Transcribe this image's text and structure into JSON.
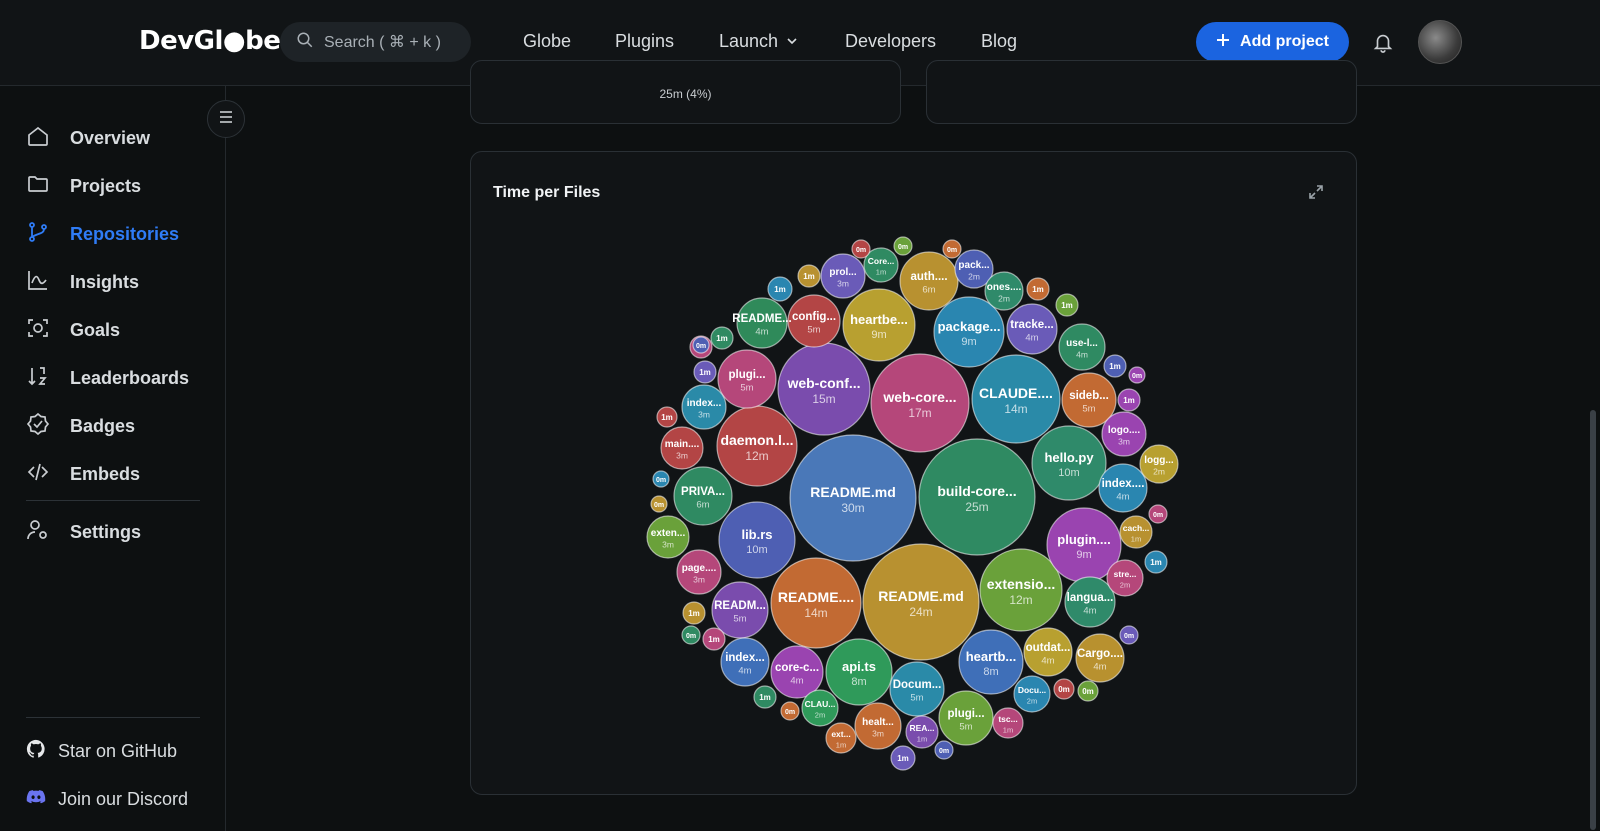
{
  "header": {
    "logo": "DevGl●be",
    "search_placeholder": "Search ( ⌘ + k )",
    "nav": [
      "Globe",
      "Plugins",
      "Launch",
      "Developers",
      "Blog"
    ],
    "add_project": "Add project"
  },
  "sidebar": {
    "items": [
      {
        "label": "Overview",
        "icon": "home-icon",
        "active": false
      },
      {
        "label": "Projects",
        "icon": "folder-icon",
        "active": false
      },
      {
        "label": "Repositories",
        "icon": "git-branch-icon",
        "active": true
      },
      {
        "label": "Insights",
        "icon": "chart-icon",
        "active": false
      },
      {
        "label": "Goals",
        "icon": "target-icon",
        "active": false
      },
      {
        "label": "Leaderboards",
        "icon": "sort-icon",
        "active": false
      },
      {
        "label": "Badges",
        "icon": "badge-icon",
        "active": false
      },
      {
        "label": "Embeds",
        "icon": "code-icon",
        "active": false
      },
      {
        "label": "Settings",
        "icon": "user-settings-icon",
        "active": false
      }
    ],
    "footer": [
      {
        "label": "Star on GitHub",
        "icon": "github-icon"
      },
      {
        "label": "Join our Discord",
        "icon": "discord-icon"
      }
    ]
  },
  "top_card": {
    "value": "25m (4%)"
  },
  "time_card": {
    "title": "Time per Files"
  },
  "colors": {
    "accent": "#1b64e0",
    "active": "#2f7cf6"
  },
  "chart_data": {
    "type": "bubble",
    "title": "Time per Files",
    "bubbles": [
      {
        "label": "README.md",
        "value": "30m",
        "color": "#4a78b8"
      },
      {
        "label": "build-core...",
        "value": "25m",
        "color": "#2f8a62"
      },
      {
        "label": "README.md",
        "value": "24m",
        "color": "#b89130"
      },
      {
        "label": "web-core...",
        "value": "17m",
        "color": "#b5477a"
      },
      {
        "label": "web-conf...",
        "value": "15m",
        "color": "#7a4cad"
      },
      {
        "label": "CLAUDE....",
        "value": "14m",
        "color": "#2a8aa8"
      },
      {
        "label": "README....",
        "value": "14m",
        "color": "#c26a33"
      },
      {
        "label": "daemon.l...",
        "value": "12m",
        "color": "#b34545"
      },
      {
        "label": "extensio...",
        "value": "12m",
        "color": "#6aa13a"
      },
      {
        "label": "lib.rs",
        "value": "10m",
        "color": "#4e5fb3"
      },
      {
        "label": "hello.py",
        "value": "10m",
        "color": "#2f8a6a"
      },
      {
        "label": "heartbe...",
        "value": "9m",
        "color": "#b8a030"
      },
      {
        "label": "package...",
        "value": "9m",
        "color": "#2a86b0"
      },
      {
        "label": "plugin....",
        "value": "9m",
        "color": "#9a44b0"
      },
      {
        "label": "api.ts",
        "value": "8m",
        "color": "#2f9a5a"
      },
      {
        "label": "heartb...",
        "value": "8m",
        "color": "#3f6fb8"
      },
      {
        "label": "auth....",
        "value": "6m",
        "color": "#b89130"
      },
      {
        "label": "PRIVA...",
        "value": "6m",
        "color": "#2f8a62"
      },
      {
        "label": "plugi...",
        "value": "5m",
        "color": "#b5477a"
      },
      {
        "label": "sideb...",
        "value": "5m",
        "color": "#c26a33"
      },
      {
        "label": "READM...",
        "value": "5m",
        "color": "#7a4cad"
      },
      {
        "label": "Docum...",
        "value": "5m",
        "color": "#2a8aa8"
      },
      {
        "label": "plugi...",
        "value": "5m",
        "color": "#6aa13a"
      },
      {
        "label": "config...",
        "value": "5m",
        "color": "#b34545"
      },
      {
        "label": "README...",
        "value": "4m",
        "color": "#2f8a5a"
      },
      {
        "label": "tracke...",
        "value": "4m",
        "color": "#6a5bb8"
      },
      {
        "label": "use-l...",
        "value": "4m",
        "color": "#2f8a62"
      },
      {
        "label": "index....",
        "value": "4m",
        "color": "#2a86b0"
      },
      {
        "label": "langua...",
        "value": "4m",
        "color": "#2f8a6a"
      },
      {
        "label": "index...",
        "value": "4m",
        "color": "#3f6fb8"
      },
      {
        "label": "core-c...",
        "value": "4m",
        "color": "#9a44b0"
      },
      {
        "label": "outdat...",
        "value": "4m",
        "color": "#b8a030"
      },
      {
        "label": "Cargo....",
        "value": "4m",
        "color": "#b8912f"
      },
      {
        "label": "prol...",
        "value": "3m",
        "color": "#6a5bb8"
      },
      {
        "label": "index...",
        "value": "3m",
        "color": "#2a8aa8"
      },
      {
        "label": "main....",
        "value": "3m",
        "color": "#b34545"
      },
      {
        "label": "exten...",
        "value": "3m",
        "color": "#6aa13a"
      },
      {
        "label": "page....",
        "value": "3m",
        "color": "#b5477a"
      },
      {
        "label": "logo....",
        "value": "3m",
        "color": "#9a44b0"
      },
      {
        "label": "healt...",
        "value": "3m",
        "color": "#c26a33"
      },
      {
        "label": "pack...",
        "value": "2m",
        "color": "#4e5fb3"
      },
      {
        "label": "ones....",
        "value": "2m",
        "color": "#2f8a6a"
      },
      {
        "label": "logg...",
        "value": "2m",
        "color": "#b8a030"
      },
      {
        "label": "stre...",
        "value": "2m",
        "color": "#b5477a"
      },
      {
        "label": "CLAU...",
        "value": "2m",
        "color": "#2f9a5a"
      },
      {
        "label": "Docu...",
        "value": "2m",
        "color": "#2a86b0"
      },
      {
        "label": "Core...",
        "value": "1m",
        "color": "#2f8a62"
      },
      {
        "label": "cach...",
        "value": "1m",
        "color": "#b89130"
      },
      {
        "label": "REA...",
        "value": "1m",
        "color": "#7a4cad"
      },
      {
        "label": "tsc...",
        "value": "1m",
        "color": "#b5477a"
      },
      {
        "label": "ext...",
        "value": "1m",
        "color": "#c26a33"
      }
    ],
    "small_values": [
      "1m",
      "1m",
      "1m",
      "1m",
      "1m",
      "1m",
      "1m",
      "1m",
      "1m",
      "1m",
      "1m",
      "1m",
      "1m",
      "1m",
      "1m",
      "0m",
      "0m",
      "0m",
      "0m",
      "0m",
      "0m",
      "0m",
      "0m",
      "0m",
      "0m",
      "0m",
      "0m",
      "0m",
      "0m"
    ]
  }
}
